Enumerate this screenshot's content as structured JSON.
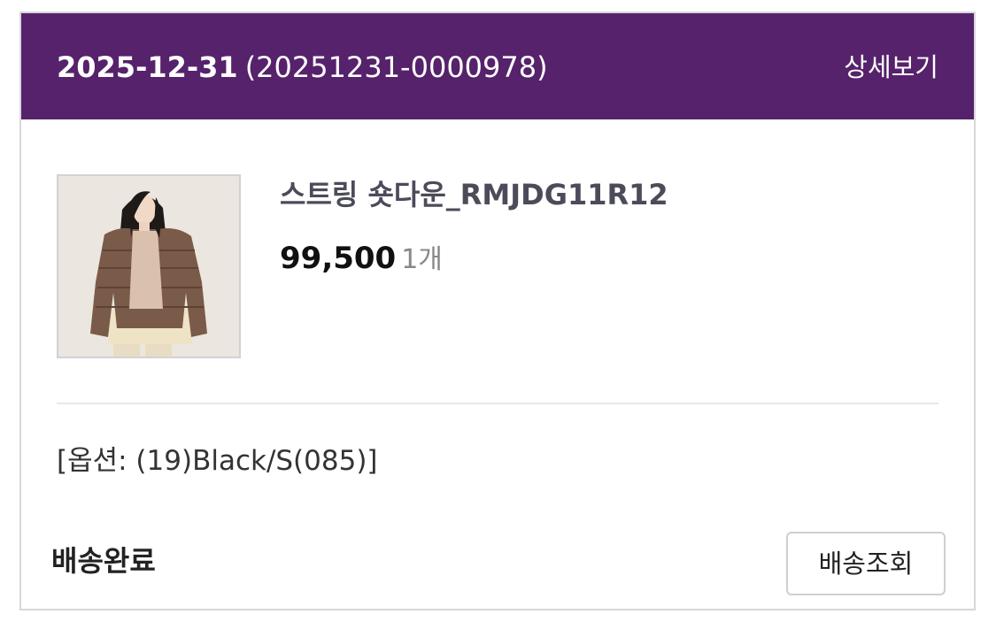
{
  "order": {
    "date": "2025-12-31",
    "number": "(20251231-0000978)",
    "detail_link": "상세보기"
  },
  "product": {
    "name": "스트링 숏다운_RMJDG11R12",
    "price": "99,500",
    "quantity": "1개",
    "option": "[옵션: (19)Black/S(085)]",
    "image": "product-photo-brown-puffer-jacket"
  },
  "delivery": {
    "status": "배송완료",
    "track_button": "배송조회"
  },
  "colors": {
    "header_bg": "#56226b",
    "header_text": "#ffffff",
    "border": "#d7d7db"
  }
}
